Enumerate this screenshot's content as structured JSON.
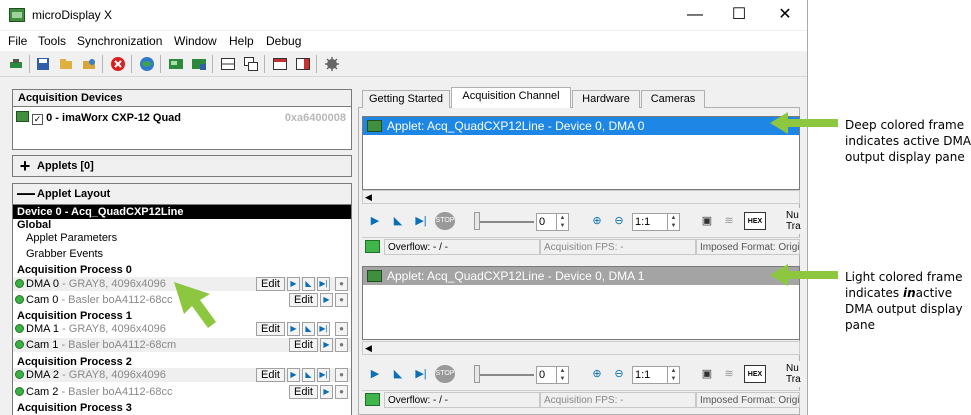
{
  "window": {
    "title": "microDisplay X",
    "controls": {
      "minimize": "—",
      "maximize": "☐",
      "close": "✕"
    }
  },
  "menu": [
    "File",
    "Tools",
    "Synchronization",
    "Window",
    "Help",
    "Debug"
  ],
  "left": {
    "acq_devices_header": "Acquisition Devices",
    "device": {
      "label": "0 - imaWorx CXP-12 Quad",
      "address": "0xa6400008"
    },
    "applets_header": "Applets [0]",
    "applet_layout_header": "Applet Layout",
    "device_row": "Device 0 - Acq_QuadCXP12Line",
    "global": "Global",
    "applet_parameters": "Applet Parameters",
    "grabber_events": "Grabber Events",
    "processes": [
      {
        "name": "Acquisition Process 0",
        "dma": "DMA 0",
        "dma_desc": " - GRAY8, 4096x4096",
        "cam": "Cam 0",
        "cam_desc": " - Basler boA4112-68cc"
      },
      {
        "name": "Acquisition Process 1",
        "dma": "DMA 1",
        "dma_desc": " - GRAY8, 4096x4096",
        "cam": "Cam 1",
        "cam_desc": " - Basler boA4112-68cm"
      },
      {
        "name": "Acquisition Process 2",
        "dma": "DMA 2",
        "dma_desc": " - GRAY8, 4096x4096",
        "cam": "Cam 2",
        "cam_desc": " - Basler boA4112-68cc"
      }
    ],
    "process3_name": "Acquisition Process 3",
    "edit_label": "Edit"
  },
  "tabs": [
    "Getting Started",
    "Acquisition Channel",
    "Hardware",
    "Cameras"
  ],
  "panes": [
    {
      "title": "Applet: Acq_QuadCXP12Line - Device 0, DMA 0",
      "color": "#1e87e6",
      "frame_value": "0",
      "zoom": "1:1",
      "overflow": "Overflow: - / -",
      "fps": "Acquisition FPS: -",
      "format": "Imposed Format: Origin",
      "nu": "Nu",
      "tra": "Tra"
    },
    {
      "title": "Applet: Acq_QuadCXP12Line - Device 0, DMA 1",
      "color": "#a4a4a4",
      "frame_value": "0",
      "zoom": "1:1",
      "overflow": "Overflow: - / -",
      "fps": "Acquisition FPS: -",
      "format": "Imposed Format: Origin",
      "nu": "Nu",
      "tra": "Tra"
    }
  ],
  "annotations": {
    "active": "Deep colored frame indicates active DMA output display pane",
    "inactive_pre": "Light colored frame indicates ",
    "inactive_em": "in",
    "inactive_post": "active DMA output display pane"
  },
  "colors": {
    "arrow": "#8dc63f",
    "active_frame": "#1e87e6",
    "inactive_frame": "#a4a4a4"
  }
}
